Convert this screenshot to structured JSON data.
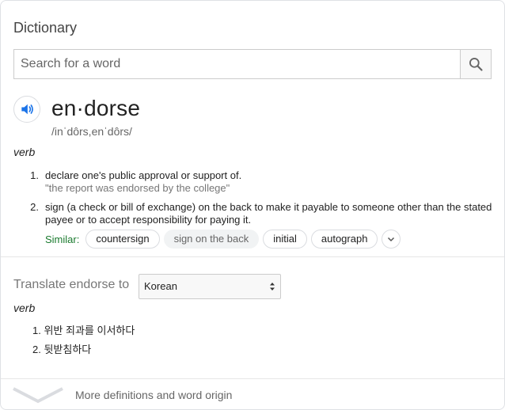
{
  "panel": {
    "title": "Dictionary"
  },
  "search": {
    "placeholder": "Search for a word",
    "value": ""
  },
  "entry": {
    "word": "en·dorse",
    "phonetic": "/inˈdôrs,enˈdôrs/",
    "part_of_speech": "verb",
    "definitions": [
      {
        "number": "1.",
        "text": "declare one's public approval or support of.",
        "example": "\"the report was endorsed by the college\""
      },
      {
        "number": "2.",
        "text": "sign (a check or bill of exchange) on the back to make it payable to someone other than the stated payee or to accept responsibility for paying it."
      }
    ],
    "similar_label": "Similar:",
    "similar": [
      "countersign",
      "sign on the back",
      "initial",
      "autograph"
    ]
  },
  "translate": {
    "label": "Translate endorse to",
    "language": "Korean",
    "part_of_speech": "verb",
    "items": [
      {
        "number": "1.",
        "text": "위반 죄과를 이서하다"
      },
      {
        "number": "2.",
        "text": "뒷받침하다"
      }
    ]
  },
  "footer": {
    "more_label": "More definitions and word origin"
  },
  "icons": [
    "search-icon",
    "speaker-icon",
    "chevron-down-icon",
    "select-arrows-icon",
    "expand-chevron-icon"
  ],
  "colors": {
    "accent_blue": "#1a73e8",
    "similar_green": "#1a7a2e",
    "muted": "#777777"
  }
}
